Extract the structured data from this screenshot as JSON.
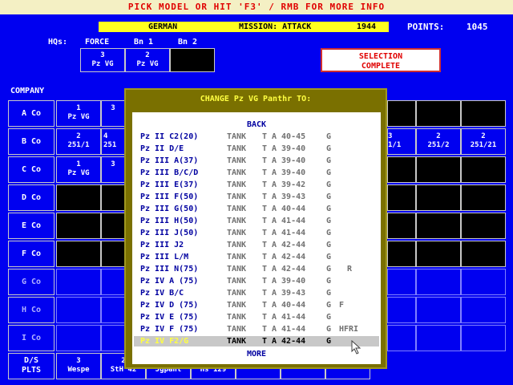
{
  "header": {
    "prompt": "PICK MODEL OR HIT 'F3' / RMB FOR MORE INFO",
    "nation": "GERMAN",
    "mission": "MISSION: ATTACK",
    "year": "1944",
    "points_label": "POINTS:",
    "points_value": "1045"
  },
  "hqs": {
    "label": "HQs:",
    "force": "FORCE",
    "bn1": "Bn 1",
    "bn2": "Bn 2",
    "units": [
      {
        "n": "3",
        "t": "Pz VG"
      },
      {
        "n": "2",
        "t": "Pz VG"
      }
    ]
  },
  "selection_button": {
    "line1": "SELECTION",
    "line2": "COMPLETE"
  },
  "company_label": "COMPANY",
  "rows": [
    {
      "label": "A Co",
      "units": [
        {
          "n": "1",
          "t": "Pz VG"
        },
        {
          "n": "3",
          "t": ""
        }
      ]
    },
    {
      "label": "B Co",
      "units": [
        {
          "n": "2",
          "t": "251/1"
        },
        {
          "n": "4",
          "t": "251"
        }
      ],
      "right": [
        {
          "n": "3",
          "t": "1/1"
        },
        {
          "n": "2",
          "t": "251/2"
        },
        {
          "n": "2",
          "t": "251/21"
        }
      ]
    },
    {
      "label": "C Co",
      "units": [
        {
          "n": "1",
          "t": "Pz VG"
        },
        {
          "n": "3",
          "t": ""
        }
      ]
    },
    {
      "label": "D Co"
    },
    {
      "label": "E Co"
    },
    {
      "label": "F Co"
    },
    {
      "label": "G Co"
    },
    {
      "label": "H Co"
    },
    {
      "label": "I Co"
    }
  ],
  "ds_row": {
    "label1": "D/S",
    "label2": "PLTS",
    "units": [
      {
        "n": "3",
        "t": "Wespe"
      },
      {
        "n": "2",
        "t": "StH 42"
      },
      {
        "n": "",
        "t": "Jgpant"
      },
      {
        "n": "",
        "t": "Hs 129"
      }
    ]
  },
  "dialog": {
    "title": "CHANGE Pz VG Panthr TO:",
    "back": "BACK",
    "more": "MORE",
    "items": [
      {
        "name": "Pz II C2(20)",
        "cls": "TANK",
        "type": "T",
        "years": "A 40-45",
        "country": "G",
        "flag": ""
      },
      {
        "name": "Pz II D/E",
        "cls": "TANK",
        "type": "T",
        "years": "A 39-40",
        "country": "G",
        "flag": ""
      },
      {
        "name": "Pz III A(37)",
        "cls": "TANK",
        "type": "T",
        "years": "A 39-40",
        "country": "G",
        "flag": ""
      },
      {
        "name": "Pz III B/C/D",
        "cls": "TANK",
        "type": "T",
        "years": "A 39-40",
        "country": "G",
        "flag": ""
      },
      {
        "name": "Pz III E(37)",
        "cls": "TANK",
        "type": "T",
        "years": "A 39-42",
        "country": "G",
        "flag": ""
      },
      {
        "name": "Pz III F(50)",
        "cls": "TANK",
        "type": "T",
        "years": "A 39-43",
        "country": "G",
        "flag": ""
      },
      {
        "name": "Pz III G(50)",
        "cls": "TANK",
        "type": "T",
        "years": "A 40-44",
        "country": "G",
        "flag": ""
      },
      {
        "name": "Pz III H(50)",
        "cls": "TANK",
        "type": "T",
        "years": "A 41-44",
        "country": "G",
        "flag": ""
      },
      {
        "name": "Pz III J(50)",
        "cls": "TANK",
        "type": "T",
        "years": "A 41-44",
        "country": "G",
        "flag": ""
      },
      {
        "name": "Pz III J2",
        "cls": "TANK",
        "type": "T",
        "years": "A 42-44",
        "country": "G",
        "flag": ""
      },
      {
        "name": "Pz III L/M",
        "cls": "TANK",
        "type": "T",
        "years": "A 42-44",
        "country": "G",
        "flag": ""
      },
      {
        "name": "Pz III N(75)",
        "cls": "TANK",
        "type": "T",
        "years": "A 42-44",
        "country": "G",
        "flag": "R"
      },
      {
        "name": "Pz IV A (75)",
        "cls": "TANK",
        "type": "T",
        "years": "A 39-40",
        "country": "G",
        "flag": ""
      },
      {
        "name": "Pz IV B/C",
        "cls": "TANK",
        "type": "T",
        "years": "A 39-43",
        "country": "G",
        "flag": ""
      },
      {
        "name": "Pz IV D (75)",
        "cls": "TANK",
        "type": "T",
        "years": "A 40-44",
        "country": "G",
        "flag": "F"
      },
      {
        "name": "Pz IV E (75)",
        "cls": "TANK",
        "type": "T",
        "years": "A 41-44",
        "country": "G",
        "flag": ""
      },
      {
        "name": "Pz IV F (75)",
        "cls": "TANK",
        "type": "T",
        "years": "A 41-44",
        "country": "G",
        "flag": "HFRI"
      },
      {
        "name": "Pz IV F2/G",
        "cls": "TANK",
        "type": "T",
        "years": "A 42-44",
        "country": "G",
        "flag": ""
      }
    ]
  }
}
